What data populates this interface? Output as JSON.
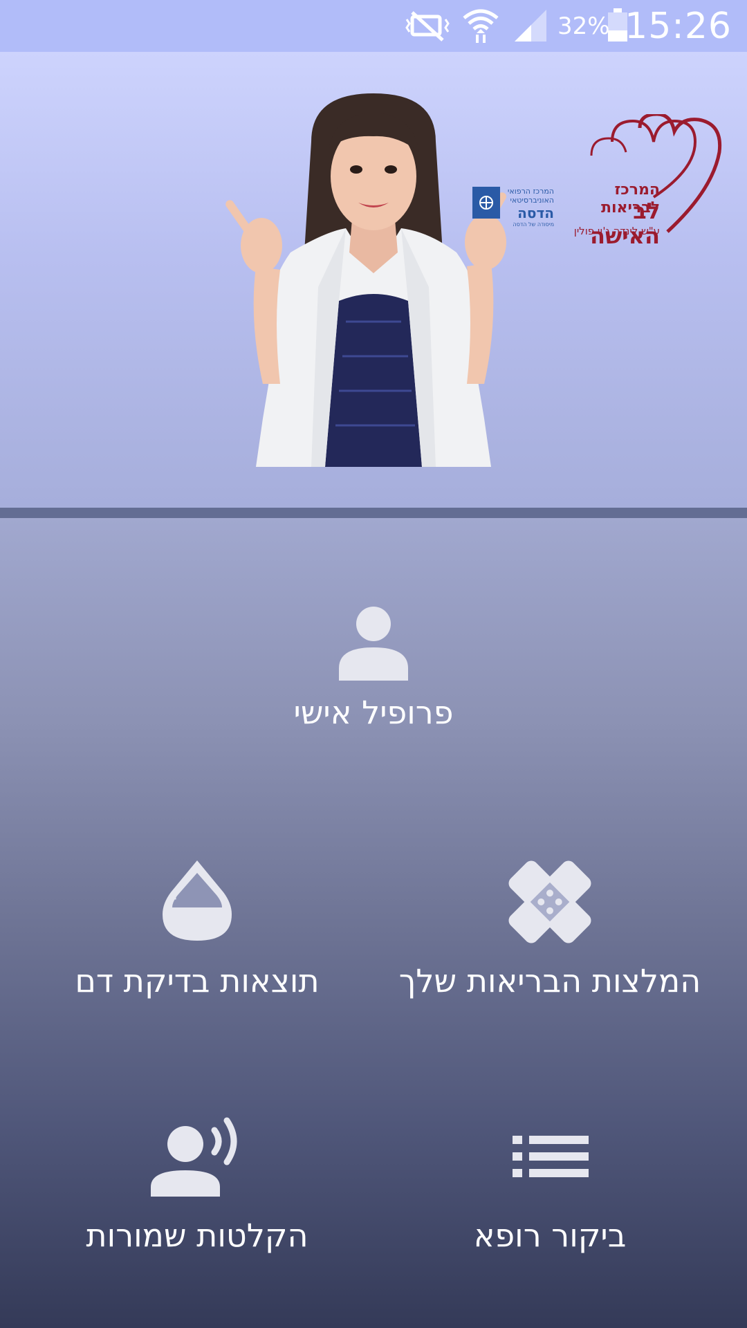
{
  "status_bar": {
    "battery_percent": "32%",
    "time": "15:26",
    "icons": [
      "mute-icon",
      "wifi-icon",
      "signal-icon",
      "battery-icon"
    ]
  },
  "hero": {
    "logo": {
      "title_line1": "המרכז לבריאות",
      "title_line2": "לב האישה",
      "subtitle": "ע\"ש לינדה ג'וי פולין",
      "partner_line1": "המרכז הרפואי",
      "partner_line2": "האוניברסיטאי",
      "partner_name": "הדסה",
      "partner_tagline": "מיסודה של הדסה"
    }
  },
  "menu": {
    "profile_label": "פרופיל אישי",
    "health_tips_label": "המלצות הבריאות שלך",
    "blood_test_label": "תוצאות בדיקת דם",
    "doctor_visit_label": "ביקור רופא",
    "saved_recordings_label": "הקלטות שמורות"
  },
  "colors": {
    "status_bar": "#b1bcf9",
    "heart_logo": "#9b1b2e",
    "hadassah_blue": "#2a5aa6",
    "icon_fill": "#e6e7ef"
  }
}
